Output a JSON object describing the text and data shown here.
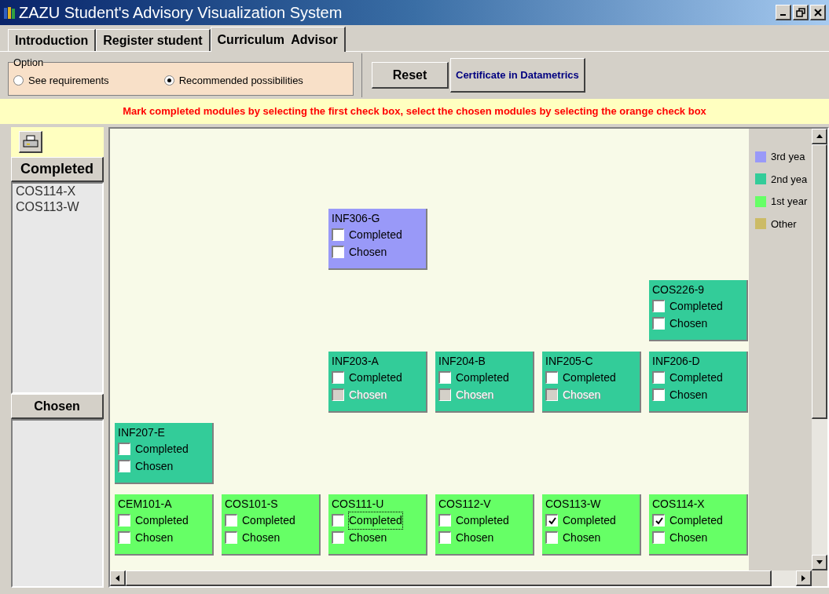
{
  "window": {
    "title": "ZAZU Student's Advisory Visualization System"
  },
  "tabs": [
    {
      "label": "Introduction",
      "selected": false
    },
    {
      "label": "Register student",
      "selected": false
    },
    {
      "label": "Curriculum  Advisor",
      "selected": true
    }
  ],
  "option": {
    "legend": "Option",
    "choices": [
      {
        "label": "See requirements",
        "selected": false
      },
      {
        "label": "Recommended possibilities",
        "selected": true
      }
    ]
  },
  "buttons": {
    "reset": "Reset",
    "certificate": "Certificate in Datametrics"
  },
  "banner": "Mark completed modules by selecting the first check box, select the chosen modules by selecting the orange check box",
  "sidebar": {
    "completed_title": "Completed",
    "completed_items": [
      "COS114-X",
      "COS113-W"
    ],
    "chosen_title": "Chosen"
  },
  "legend": [
    {
      "label": "3rd yea",
      "color": "#9999f8"
    },
    {
      "label": "2nd yea",
      "color": "#33cc99"
    },
    {
      "label": "1st year",
      "color": "#66ff66"
    },
    {
      "label": "Other",
      "color": "#ccbb66"
    }
  ],
  "module_rows": [
    [
      null,
      null,
      {
        "code": "INF306-G",
        "color": "#9999f8",
        "completed": {
          "label": "Completed",
          "checked": false,
          "disabled": false,
          "focused": false
        },
        "chosen": {
          "label": "Chosen",
          "checked": false,
          "disabled": false,
          "focused": false
        }
      },
      null,
      null,
      null
    ],
    [
      null,
      null,
      null,
      null,
      null,
      {
        "code": "COS226-9",
        "color": "#33cc99",
        "completed": {
          "label": "Completed",
          "checked": false,
          "disabled": false,
          "focused": false
        },
        "chosen": {
          "label": "Chosen",
          "checked": false,
          "disabled": false,
          "focused": false
        }
      }
    ],
    [
      null,
      null,
      {
        "code": "INF203-A",
        "color": "#33cc99",
        "completed": {
          "label": "Completed",
          "checked": false,
          "disabled": false,
          "focused": false
        },
        "chosen": {
          "label": "Chosen",
          "checked": false,
          "disabled": true,
          "focused": false
        }
      },
      {
        "code": "INF204-B",
        "color": "#33cc99",
        "completed": {
          "label": "Completed",
          "checked": false,
          "disabled": false,
          "focused": false
        },
        "chosen": {
          "label": "Chosen",
          "checked": false,
          "disabled": true,
          "focused": false
        }
      },
      {
        "code": "INF205-C",
        "color": "#33cc99",
        "completed": {
          "label": "Completed",
          "checked": false,
          "disabled": false,
          "focused": false
        },
        "chosen": {
          "label": "Chosen",
          "checked": false,
          "disabled": true,
          "focused": false
        }
      },
      {
        "code": "INF206-D",
        "color": "#33cc99",
        "completed": {
          "label": "Completed",
          "checked": false,
          "disabled": false,
          "focused": false
        },
        "chosen": {
          "label": "Chosen",
          "checked": false,
          "disabled": false,
          "focused": false
        }
      }
    ],
    [
      {
        "code": "INF207-E",
        "color": "#33cc99",
        "completed": {
          "label": "Completed",
          "checked": false,
          "disabled": false,
          "focused": false
        },
        "chosen": {
          "label": "Chosen",
          "checked": false,
          "disabled": false,
          "focused": false
        }
      },
      null,
      null,
      null,
      null,
      null
    ],
    [
      {
        "code": "CEM101-A",
        "color": "#66ff66",
        "completed": {
          "label": "Completed",
          "checked": false,
          "disabled": false,
          "focused": false
        },
        "chosen": {
          "label": "Chosen",
          "checked": false,
          "disabled": false,
          "focused": false
        }
      },
      {
        "code": "COS101-S",
        "color": "#66ff66",
        "completed": {
          "label": "Completed",
          "checked": false,
          "disabled": false,
          "focused": false
        },
        "chosen": {
          "label": "Chosen",
          "checked": false,
          "disabled": false,
          "focused": false
        }
      },
      {
        "code": "COS111-U",
        "color": "#66ff66",
        "completed": {
          "label": "Completed",
          "checked": false,
          "disabled": false,
          "focused": true
        },
        "chosen": {
          "label": "Chosen",
          "checked": false,
          "disabled": false,
          "focused": false
        }
      },
      {
        "code": "COS112-V",
        "color": "#66ff66",
        "completed": {
          "label": "Completed",
          "checked": false,
          "disabled": false,
          "focused": false
        },
        "chosen": {
          "label": "Chosen",
          "checked": false,
          "disabled": false,
          "focused": false
        }
      },
      {
        "code": "COS113-W",
        "color": "#66ff66",
        "completed": {
          "label": "Completed",
          "checked": true,
          "disabled": false,
          "focused": false
        },
        "chosen": {
          "label": "Chosen",
          "checked": false,
          "disabled": false,
          "focused": false
        }
      },
      {
        "code": "COS114-X",
        "color": "#66ff66",
        "completed": {
          "label": "Completed",
          "checked": true,
          "disabled": false,
          "focused": false
        },
        "chosen": {
          "label": "Chosen",
          "checked": false,
          "disabled": false,
          "focused": false
        }
      }
    ]
  ]
}
